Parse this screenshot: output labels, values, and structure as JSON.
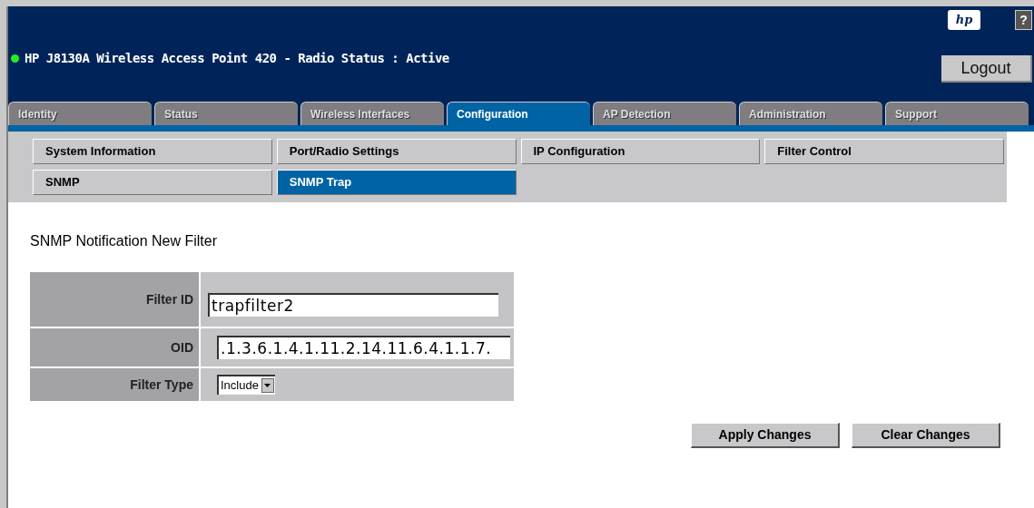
{
  "header": {
    "title": "HP J8130A Wireless Access Point 420 - Radio Status : Active",
    "logo": "hp",
    "help": "?",
    "logout": "Logout"
  },
  "tabs": [
    {
      "label": "Identity",
      "selected": false
    },
    {
      "label": "Status",
      "selected": false
    },
    {
      "label": "Wireless Interfaces",
      "selected": false
    },
    {
      "label": "Configuration",
      "selected": true
    },
    {
      "label": "AP Detection",
      "selected": false
    },
    {
      "label": "Administration",
      "selected": false
    },
    {
      "label": "Support",
      "selected": false
    }
  ],
  "subnav": [
    {
      "label": "System Information",
      "selected": false
    },
    {
      "label": "Port/Radio Settings",
      "selected": false
    },
    {
      "label": "IP Configuration",
      "selected": false
    },
    {
      "label": "Filter Control",
      "selected": false
    },
    {
      "label": "SNMP",
      "selected": false
    },
    {
      "label": "SNMP Trap",
      "selected": true
    }
  ],
  "form": {
    "title": "SNMP Notification New Filter",
    "fields": [
      {
        "kind": "text",
        "label": "Filter ID",
        "value": "trapfilter2"
      },
      {
        "kind": "text",
        "label": "OID",
        "value": ".1.3.6.1.4.1.11.2.14.11.6.4.1.1.7."
      },
      {
        "kind": "select",
        "label": "Filter Type",
        "value": "Include"
      }
    ]
  },
  "buttons": [
    "Apply Changes",
    "Clear Changes"
  ]
}
